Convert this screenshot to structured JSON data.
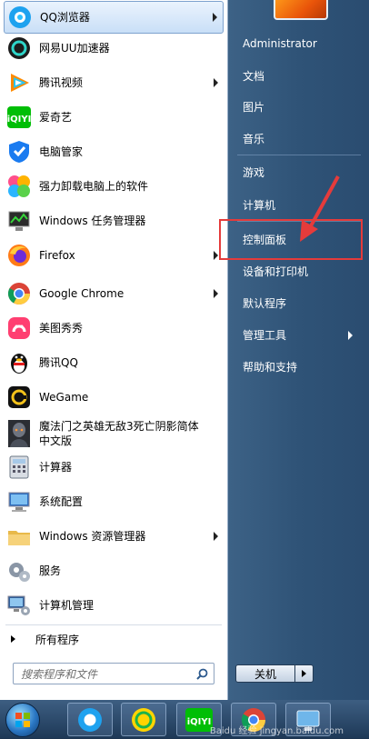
{
  "programs": [
    {
      "label": "QQ浏览器",
      "icon": "qq-browser-icon",
      "has_arrow": true
    },
    {
      "label": "网易UU加速器",
      "icon": "uu-accelerator-icon",
      "has_arrow": false
    },
    {
      "label": "腾讯视频",
      "icon": "tencent-video-icon",
      "has_arrow": true
    },
    {
      "label": "爱奇艺",
      "icon": "iqiyi-icon",
      "has_arrow": false
    },
    {
      "label": "电脑管家",
      "icon": "pc-manager-icon",
      "has_arrow": false
    },
    {
      "label": "强力卸载电脑上的软件",
      "icon": "uninstaller-icon",
      "has_arrow": false
    },
    {
      "label": "Windows 任务管理器",
      "icon": "task-manager-icon",
      "has_arrow": false
    },
    {
      "label": "Firefox",
      "icon": "firefox-icon",
      "has_arrow": true
    },
    {
      "label": "Google Chrome",
      "icon": "chrome-icon",
      "has_arrow": true
    },
    {
      "label": "美图秀秀",
      "icon": "meitu-icon",
      "has_arrow": false
    },
    {
      "label": "腾讯QQ",
      "icon": "qq-penguin-icon",
      "has_arrow": false
    },
    {
      "label": "WeGame",
      "icon": "wegame-icon",
      "has_arrow": false
    },
    {
      "label": "魔法门之英雄无敌3死亡阴影简体中文版",
      "line1": "魔法门之英雄无敌3死亡阴影简体",
      "line2": "中文版",
      "icon": "heroes3-icon",
      "has_arrow": false
    },
    {
      "label": "计算器",
      "icon": "calculator-icon",
      "has_arrow": false
    },
    {
      "label": "系统配置",
      "icon": "system-config-icon",
      "has_arrow": false
    },
    {
      "label": "Windows 资源管理器",
      "icon": "explorer-icon",
      "has_arrow": true
    },
    {
      "label": "服务",
      "icon": "services-icon",
      "has_arrow": false
    },
    {
      "label": "计算机管理",
      "icon": "computer-management-icon",
      "has_arrow": false
    }
  ],
  "all_programs_label": "所有程序",
  "search": {
    "placeholder": "搜索程序和文件"
  },
  "right": {
    "user": "Administrator",
    "items": [
      "文档",
      "图片",
      "音乐",
      "游戏",
      "计算机",
      "控制面板",
      "设备和打印机",
      "默认程序",
      "管理工具",
      "帮助和支持"
    ],
    "shutdown_label": "关机"
  },
  "taskbar": {
    "apps": [
      "qq-browser-icon",
      "kugou-icon",
      "iqiyi-icon",
      "chrome-icon",
      "remote-icon"
    ],
    "watermark": "Baidu 经验 jingyan.baidu.com"
  },
  "colors": {
    "highlight": "#e53b3b",
    "right_panel": "#2f5377",
    "selected_item": "#c9dff7"
  }
}
